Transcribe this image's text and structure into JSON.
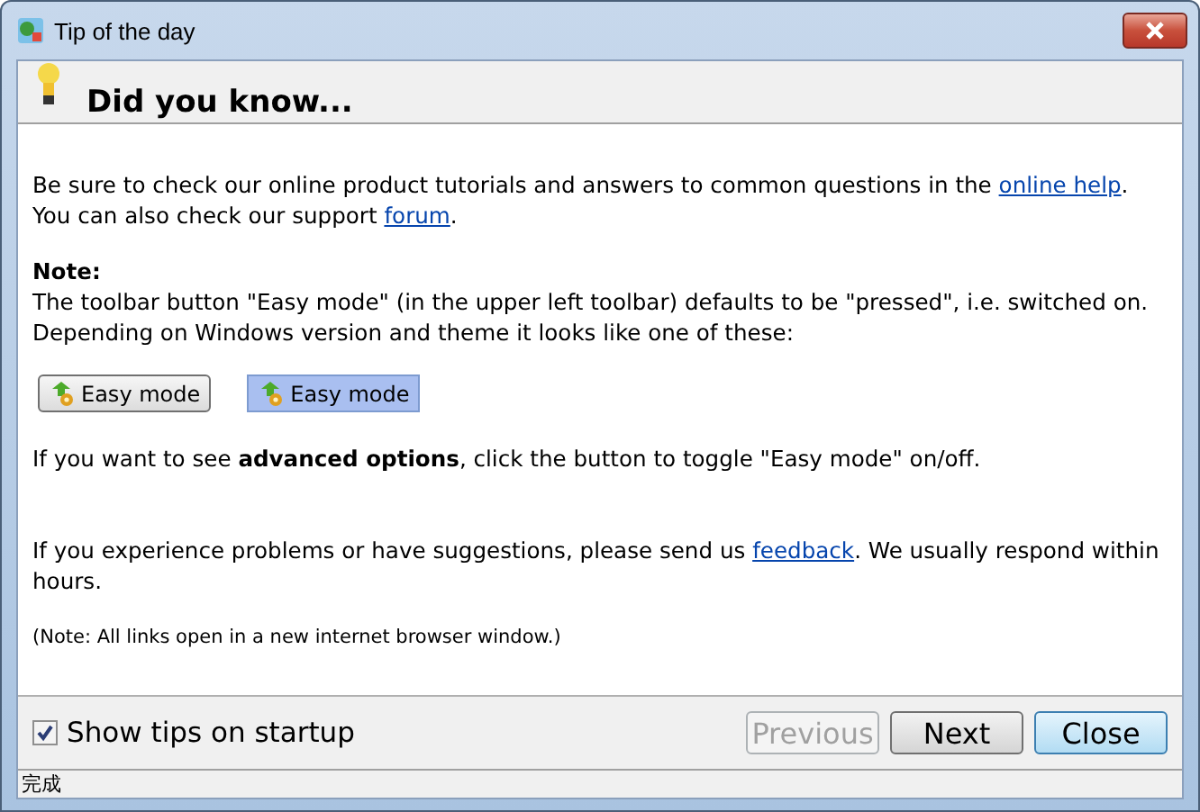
{
  "window": {
    "title": "Tip of the day"
  },
  "heading": "Did you know...",
  "paragraphs": [
    {
      "kind": "text",
      "segments": [
        {
          "kind": "text",
          "text": "Be sure to check our online product tutorials and answers to common questions in the "
        },
        {
          "kind": "link",
          "text": "online help"
        },
        {
          "kind": "text",
          "text": ". You can also check our support "
        },
        {
          "kind": "link",
          "text": "forum"
        },
        {
          "kind": "text",
          "text": "."
        }
      ]
    },
    {
      "kind": "note",
      "title": "Note:",
      "segments": [
        {
          "kind": "text",
          "text": "The toolbar button \"Easy mode\" (in the upper left toolbar) defaults to be \"pressed\", i.e. switched on. Depending on Windows version and theme it looks like one of these:"
        }
      ]
    },
    {
      "kind": "samples",
      "buttons": [
        {
          "label": "Easy mode",
          "pressed": false
        },
        {
          "label": "Easy mode",
          "pressed": true
        }
      ]
    },
    {
      "kind": "text",
      "segments": [
        {
          "kind": "text",
          "text": "If you want to see **advanced options**, click the button to toggle \"Easy mode\" on/off."
        }
      ]
    },
    {
      "kind": "text",
      "segments": [
        {
          "kind": "text",
          "text": "If you experience problems or have suggestions, please send us "
        },
        {
          "kind": "link",
          "text": "feedback"
        },
        {
          "kind": "text",
          "text": ". We usually respond within hours."
        }
      ]
    },
    {
      "kind": "small",
      "segments": [
        {
          "kind": "text",
          "text": "(Note: All links open in a new internet browser window.)"
        }
      ]
    }
  ],
  "show_tips": {
    "label": "Show tips on startup",
    "checked": true
  },
  "buttons": [
    {
      "label": "Previous",
      "disabled": true,
      "focused": false
    },
    {
      "label": "Next",
      "disabled": false,
      "focused": false
    },
    {
      "label": "Close",
      "disabled": false,
      "focused": true
    }
  ],
  "status_bar": "完成"
}
